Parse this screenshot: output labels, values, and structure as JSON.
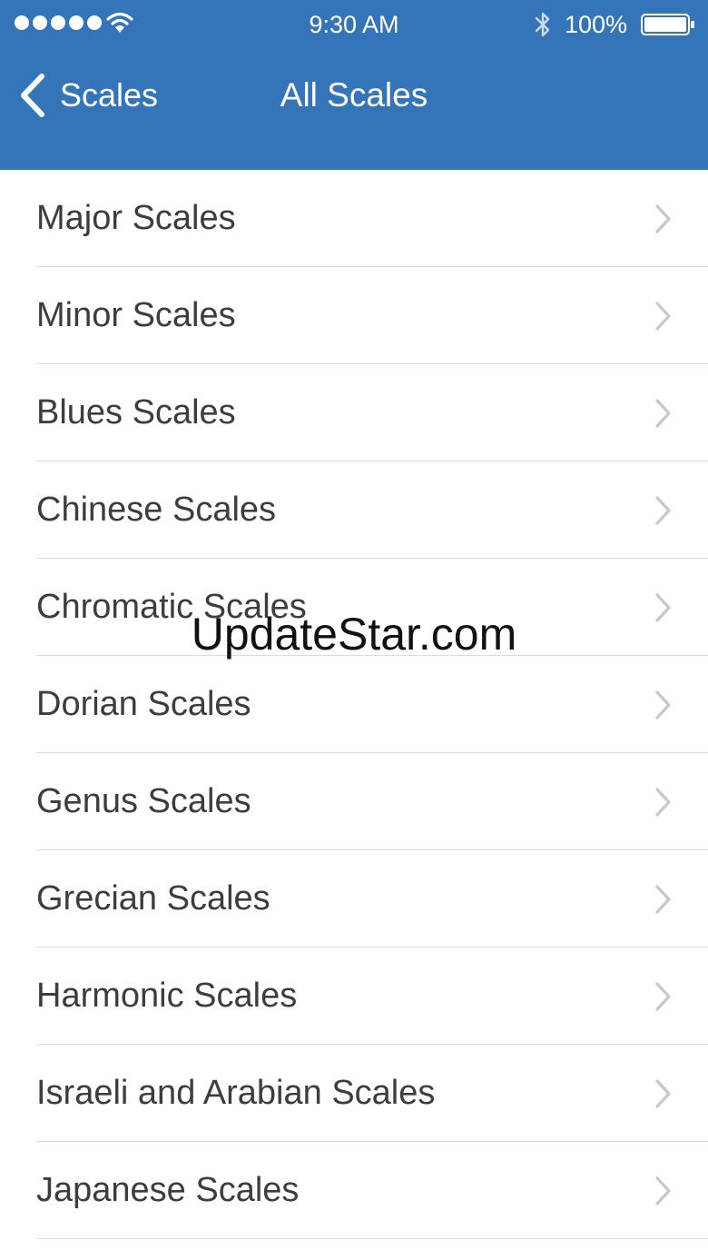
{
  "status_bar": {
    "time": "9:30 AM",
    "battery": "100%",
    "icons": [
      "signal-dots-icon",
      "wifi-icon",
      "bluetooth-icon",
      "battery-icon"
    ]
  },
  "nav": {
    "back_label": "Scales",
    "title": "All Scales"
  },
  "items": [
    {
      "label": "Major Scales"
    },
    {
      "label": "Minor Scales"
    },
    {
      "label": "Blues Scales"
    },
    {
      "label": "Chinese Scales"
    },
    {
      "label": "Chromatic Scales"
    },
    {
      "label": "Dorian Scales"
    },
    {
      "label": "Genus Scales"
    },
    {
      "label": "Grecian Scales"
    },
    {
      "label": "Harmonic Scales"
    },
    {
      "label": "Israeli and Arabian Scales"
    },
    {
      "label": "Japanese Scales"
    }
  ],
  "watermark": "UpdateStar.com",
  "colors": {
    "header": "#3474b8",
    "text": "#3d3d3d",
    "separator": "#dcdcdc",
    "chevron": "#c7c7cc"
  }
}
